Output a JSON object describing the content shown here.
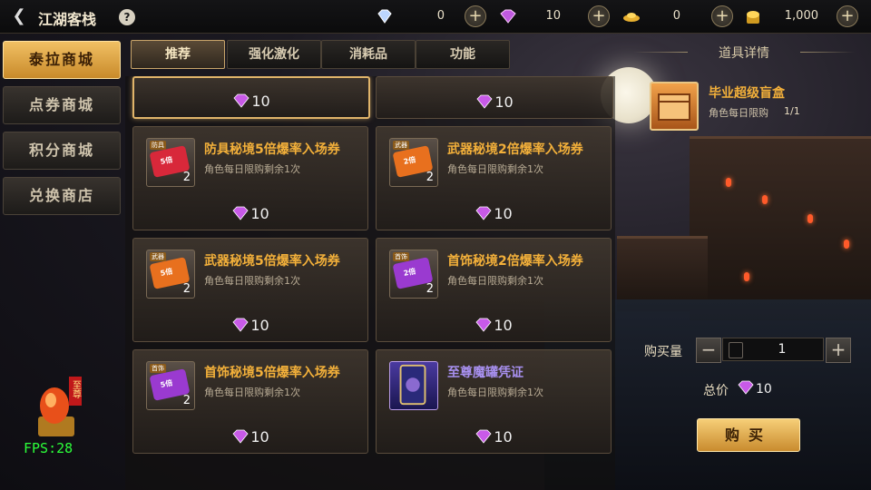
{
  "header": {
    "back_icon": "chevron-left-icon",
    "title": "江湖客栈",
    "help_icon": "question-mark-icon",
    "currencies": [
      {
        "icon": "diamond-icon",
        "value": "0"
      },
      {
        "icon": "purple-gem-icon",
        "value": "10"
      },
      {
        "icon": "gold-ingot-icon",
        "value": "0"
      },
      {
        "icon": "gold-pile-icon",
        "value": "1,000"
      }
    ]
  },
  "nav": {
    "items": [
      {
        "label": "泰拉商城",
        "active": true
      },
      {
        "label": "点券商城",
        "active": false
      },
      {
        "label": "积分商城",
        "active": false
      },
      {
        "label": "兑换商店",
        "active": false
      }
    ]
  },
  "fps": "FPS:28",
  "vip_badge": {
    "text": "至尊"
  },
  "tabs": [
    {
      "label": "推荐",
      "active": true
    },
    {
      "label": "强化激化",
      "active": false
    },
    {
      "label": "消耗品",
      "active": false
    },
    {
      "label": "功能",
      "active": false
    }
  ],
  "items": [
    {
      "name": "",
      "limit": "",
      "price": "10",
      "selected": true,
      "partial": true
    },
    {
      "name": "",
      "limit": "",
      "price": "10",
      "selected": false,
      "partial": true
    },
    {
      "name": "防具秘境5倍爆率入场券",
      "limit": "角色每日限购剩余1次",
      "price": "10",
      "tag": "防具",
      "mult": "5倍",
      "count": "2",
      "color": "#d8283a"
    },
    {
      "name": "武器秘境2倍爆率入场券",
      "limit": "角色每日限购剩余1次",
      "price": "10",
      "tag": "武器",
      "mult": "2倍",
      "count": "2",
      "color": "#e8701e"
    },
    {
      "name": "武器秘境5倍爆率入场券",
      "limit": "角色每日限购剩余1次",
      "price": "10",
      "tag": "武器",
      "mult": "5倍",
      "count": "2",
      "color": "#e8701e"
    },
    {
      "name": "首饰秘境2倍爆率入场券",
      "limit": "角色每日限购剩余1次",
      "price": "10",
      "tag": "首饰",
      "mult": "2倍",
      "count": "2",
      "color": "#9a3ad0"
    },
    {
      "name": "首饰秘境5倍爆率入场券",
      "limit": "角色每日限购剩余1次",
      "price": "10",
      "tag": "首饰",
      "mult": "5倍",
      "count": "2",
      "color": "#9a3ad0"
    },
    {
      "name": "至尊魔罐凭证",
      "limit": "角色每日限购剩余1次",
      "price": "10",
      "color": "#3a3a8a"
    }
  ],
  "detail": {
    "heading": "道具详情",
    "name": "毕业超级盲盒",
    "limit_label": "角色每日限购",
    "limit_value": "1/1",
    "qty_label": "购买量",
    "qty_value": "1",
    "total_label": "总价",
    "total_value": "10",
    "buy_label": "购买"
  },
  "colors": {
    "accent": "#f3b03a",
    "active_button": "#e0a84a"
  }
}
